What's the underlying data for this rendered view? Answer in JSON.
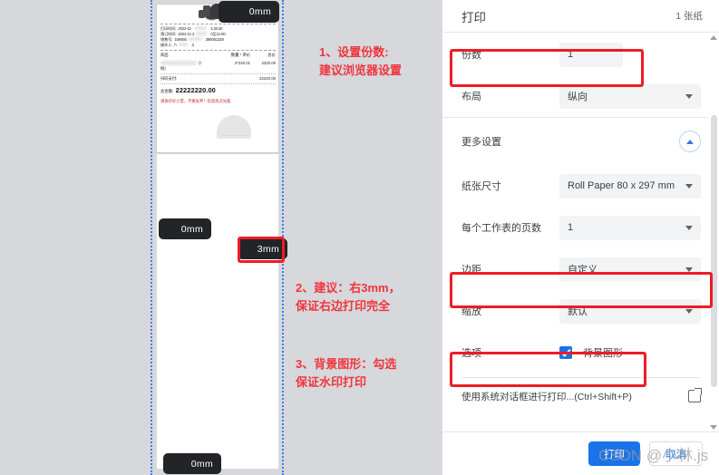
{
  "dialog": {
    "title": "打印",
    "sheets": "1 张纸",
    "rows": [
      {
        "label": "份数",
        "value": "1",
        "type": "input"
      },
      {
        "label": "布局",
        "value": "纵向",
        "type": "select"
      }
    ],
    "more_settings_label": "更多设置",
    "more_rows": [
      {
        "label": "纸张尺寸",
        "value": "Roll Paper 80 x 297 mm",
        "type": "select"
      },
      {
        "label": "每个工作表的页数",
        "value": "1",
        "type": "select"
      },
      {
        "label": "边距",
        "value": "自定义",
        "type": "select"
      },
      {
        "label": "缩放",
        "value": "默认",
        "type": "select"
      }
    ],
    "options": {
      "label": "选项",
      "checkbox_label": "背景图形",
      "checked": true
    },
    "system_dialog": "使用系统对话框进行打印...(Ctrl+Shift+P)",
    "print_button": "打印",
    "cancel_button": "取消",
    "accent_color": "#1a73e8"
  },
  "annotations": {
    "highlight_color": "#ed1c24",
    "items": [
      {
        "line1": "1、设置份数:",
        "line2": "建议浏览器设置"
      },
      {
        "line1": "2、建议：右3mm，",
        "line2": "保证右边打印完全"
      },
      {
        "line1": "3、背景图形：勾选",
        "line2": "保证水印打印"
      }
    ]
  },
  "preview": {
    "margin_badges": {
      "top": "0mm",
      "left": "0mm",
      "right": "3mm",
      "bottom": "0mm"
    },
    "receipt": {
      "meta": [
        {
          "key": "打印时间:",
          "value": "2022-11-",
          "value2": "1:30:40"
        },
        {
          "key": "预订时间:",
          "value": "2022-11-2",
          "value2": "0至21:00"
        },
        {
          "key": "销售号:",
          "value": "159456",
          "value2": "390051328"
        },
        {
          "key": "操作人:",
          "value": "h",
          "value2": ".3"
        }
      ],
      "table_headers": [
        "商品",
        "数量 * 单价",
        "总价"
      ],
      "item_row": {
        "name": "",
        "unit": "小",
        "qty_price": "2*220.01",
        "total": "2220.00"
      },
      "pay_label": "扫码支付:",
      "pay_value": "22220.00",
      "grand_label": "总金额:",
      "grand_value": "22222220.00",
      "thanks": "请保存好小票，不要丢弃！欢迎再次光临"
    }
  },
  "watermark": "CSDN @小林.js"
}
